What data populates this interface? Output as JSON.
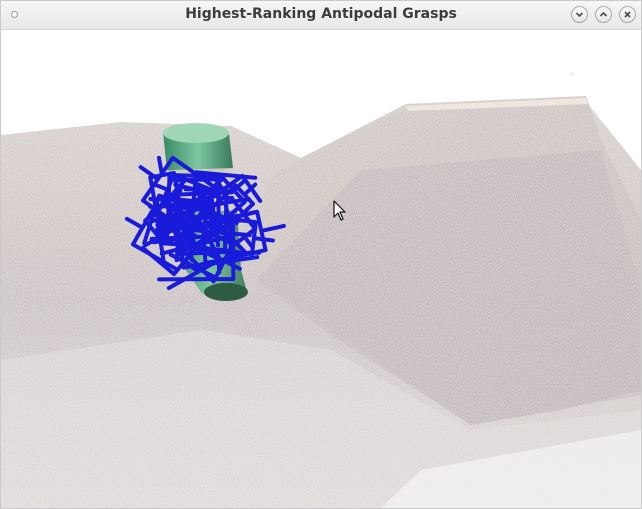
{
  "window": {
    "title": "Highest-Ranking Antipodal Grasps",
    "buttons": [
      "minimize-icon",
      "maximize-icon",
      "close-icon"
    ]
  },
  "scene": {
    "grasp_color": "#1a1adb",
    "object_color": "#58a883",
    "surface_color": "#c8beb8"
  }
}
